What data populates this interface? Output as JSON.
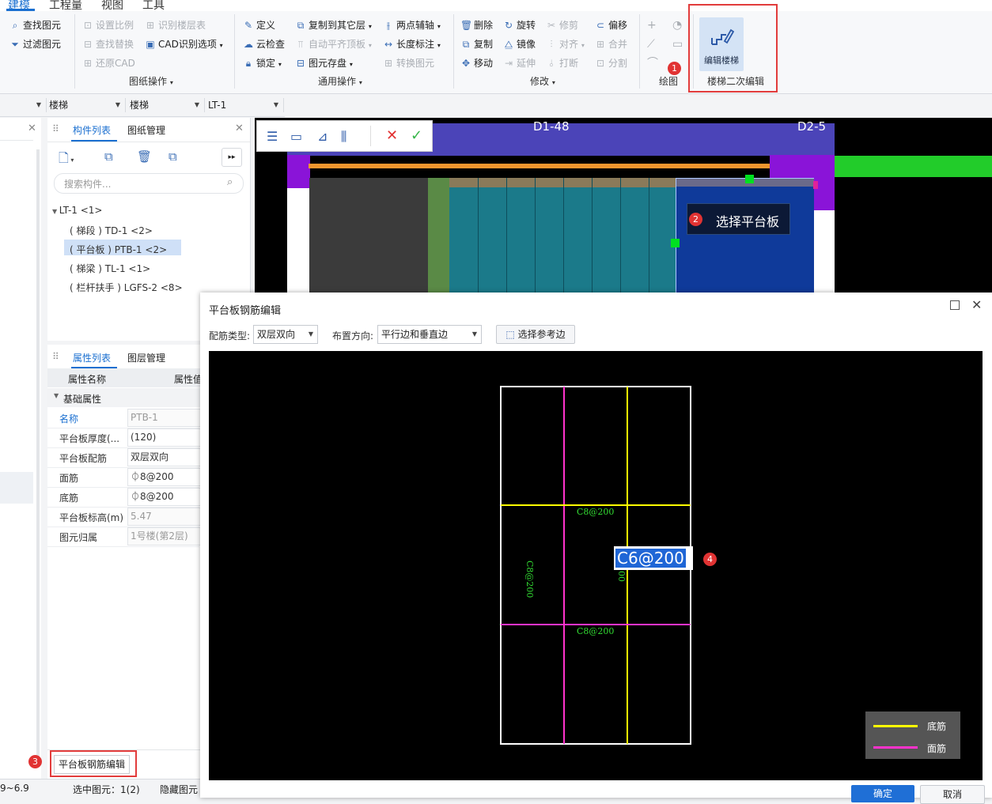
{
  "menu": {
    "items": [
      "建模",
      "工程量",
      "视图",
      "工具"
    ],
    "active": "建模"
  },
  "ribbon": {
    "col1": [
      "查找图元",
      "过滤图元"
    ],
    "col2": [
      "设置比例",
      "查找替换",
      "还原CAD"
    ],
    "col3": [
      "识别楼层表",
      "CAD识别选项"
    ],
    "col4": [
      "定义",
      "云检查",
      "锁定"
    ],
    "col5": [
      "复制到其它层",
      "自动平齐顶板",
      "图元存盘"
    ],
    "col6": [
      "两点辅轴",
      "长度标注",
      "转换图元"
    ],
    "col7": [
      "删除",
      "复制",
      "移动"
    ],
    "col8": [
      "旋转",
      "镜像",
      "延伸"
    ],
    "col9": [
      "修剪",
      "对齐",
      "打断"
    ],
    "col10": [
      "偏移",
      "合并",
      "分割"
    ],
    "groups": [
      "图纸操作",
      "通用操作",
      "修改",
      "绘图",
      "楼梯二次编辑"
    ],
    "stair_button": "编辑楼梯"
  },
  "selectors": [
    "",
    "楼梯",
    "楼梯",
    "LT-1"
  ],
  "component_panel": {
    "tabs": [
      "构件列表",
      "图纸管理"
    ],
    "search_placeholder": "搜索构件...",
    "tree": [
      "LT-1 <1>",
      "( 梯段 ) TD-1 <2>",
      "( 平台板 ) PTB-1 <2>",
      "( 梯梁 ) TL-1 <1>",
      "( 栏杆扶手 ) LGFS-2 <8>"
    ]
  },
  "property_panel": {
    "tabs": [
      "属性列表",
      "图层管理"
    ],
    "header": {
      "name": "属性名称",
      "value": "属性值"
    },
    "section": "基础属性",
    "rows": [
      {
        "k": "名称",
        "v": "PTB-1"
      },
      {
        "k": "平台板厚度(...",
        "v": "(120)"
      },
      {
        "k": "平台板配筋",
        "v": "双层双向"
      },
      {
        "k": "面筋",
        "v": "⏀8@200"
      },
      {
        "k": "底筋",
        "v": "⏀8@200"
      },
      {
        "k": "平台板标高(m)",
        "v": "5.47"
      },
      {
        "k": "图元归属",
        "v": "1号楼(第2层)"
      }
    ],
    "edit_button": "平台板钢筋编辑"
  },
  "status": {
    "coord": "9~6.9",
    "selected": "选中图元：1(2)",
    "hidden": "隐藏图元"
  },
  "canvas": {
    "axis_left": "D1-48",
    "axis_right": "D2-5",
    "tooltip": "选择平台板"
  },
  "annotations": [
    "1",
    "2",
    "3",
    "4"
  ],
  "dialog": {
    "title": "平台板钢筋编辑",
    "type_label": "配筋类型:",
    "type_value": "双层双向",
    "dir_label": "布置方向:",
    "dir_value": "平行边和垂直边",
    "ref_button": "选择参考边",
    "rebar_labels": [
      "C8@200",
      "C8@200",
      "C8@200",
      "00"
    ],
    "edit_value": "C6@200",
    "legend": [
      {
        "name": "底筋",
        "color": "#ffff00"
      },
      {
        "name": "面筋",
        "color": "#ff33cc"
      }
    ],
    "ok": "确定",
    "cancel": "取消"
  },
  "colors": {
    "accent": "#1a6fd0",
    "highlight_red": "#e23c3c"
  }
}
